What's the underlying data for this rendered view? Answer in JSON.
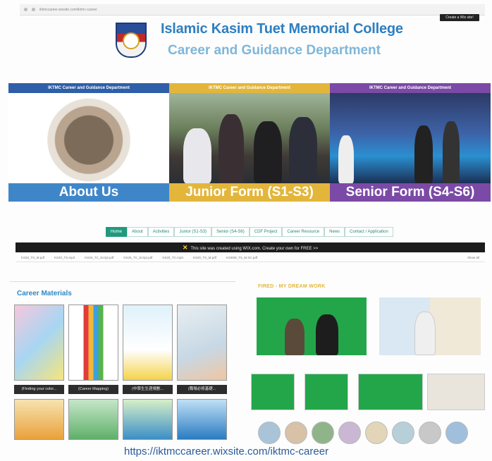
{
  "browser": {
    "address": "iktmccareer.wixsite.com/iktmc-career"
  },
  "wix_badge": "Create a Wix site!",
  "header": {
    "college": "Islamic Kasim Tuet Memorial College",
    "department": "Career and Guidance Department"
  },
  "panels": [
    {
      "title": "IKTMC Career and Guidance Department",
      "label": "About Us"
    },
    {
      "title": "IKTMC Career and Guidance Department",
      "label": "Junior Form (S1-S3)"
    },
    {
      "title": "IKTMC Career and Guidance Department",
      "label": "Senior Form (S4-S6)"
    }
  ],
  "nav": [
    "Home",
    "About",
    "Activities",
    "Junior (S1-S3)",
    "Senior (S4-S6)",
    "CDF Project",
    "Career Resource",
    "News",
    "Contact / Application"
  ],
  "wix_banner": "This site was created using WIX.com. Create your own for FREE >>",
  "downloads": [
    "KS20_TS_M.pdf",
    "KS20_TS.mp3",
    "KS20_TC_Script.pdf",
    "KS20_TC_Script.pdf",
    "KS20_TC.mp3",
    "KS20_TS_M.pdf",
    "KS30M_TS_M.SC.pdf"
  ],
  "downloads_show_all": "Show all",
  "materials": {
    "title": "Career Materials",
    "captions": [
      "(Finding your color...",
      "(Career Mapping)",
      "(中學生生涯規劃...",
      "(職場必修基礎...",
      "",
      ""
    ]
  },
  "fired": {
    "title": "FIRED - MY DREAM WORK"
  },
  "footer_url": "https://iktmccareer.wixsite.com/iktmc-career",
  "colors": {
    "junior": "#e3b63b",
    "senior": "#7b4aa6",
    "about": "#3f86c9",
    "nav_active": "#1f9a7c"
  }
}
